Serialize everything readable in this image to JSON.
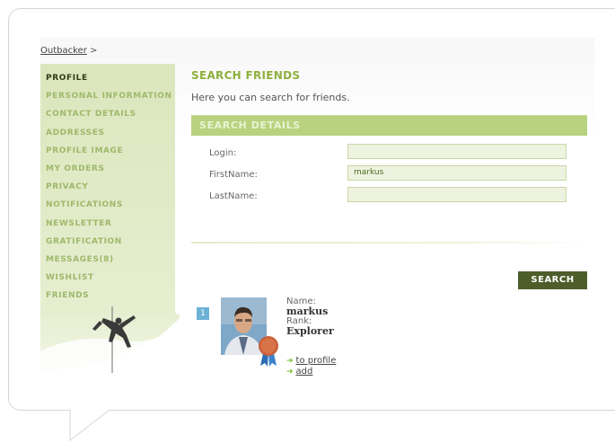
{
  "breadcrumb": {
    "link": "Outbacker",
    "separator": ">"
  },
  "sidebar": {
    "items": [
      {
        "label": "PROFILE",
        "active": true
      },
      {
        "label": "PERSONAL INFORMATION"
      },
      {
        "label": "CONTACT DETAILS"
      },
      {
        "label": "ADDRESSES"
      },
      {
        "label": "PROFILE IMAGE"
      },
      {
        "label": "MY ORDERS"
      },
      {
        "label": "PRIVACY"
      },
      {
        "label": "NOTIFICATIONS"
      },
      {
        "label": "NEWSLETTER"
      },
      {
        "label": "GRATIFICATION"
      },
      {
        "label": "MESSAGES(8)"
      },
      {
        "label": "WISHLIST"
      },
      {
        "label": "FRIENDS"
      }
    ]
  },
  "main": {
    "title": "SEARCH FRIENDS",
    "intro": "Here you can search for friends.",
    "section_title": "SEARCH DETAILS",
    "form": {
      "login_label": "Login:",
      "login_value": "",
      "firstname_label": "FirstName:",
      "firstname_value": "markus",
      "lastname_label": "LastName:",
      "lastname_value": ""
    },
    "search_button": "SEARCH",
    "result": {
      "index": "1",
      "name_label": "Name:",
      "name_value": "markus",
      "rank_label": "Rank:",
      "rank_value": "Explorer",
      "profile_link": "to profile",
      "add_link": "add"
    }
  },
  "colors": {
    "accent_green": "#8db03e",
    "sidebar_bg": "#dfe9c3",
    "button_dark": "#4d5e2b",
    "badge_blue": "#6cb1d6"
  }
}
